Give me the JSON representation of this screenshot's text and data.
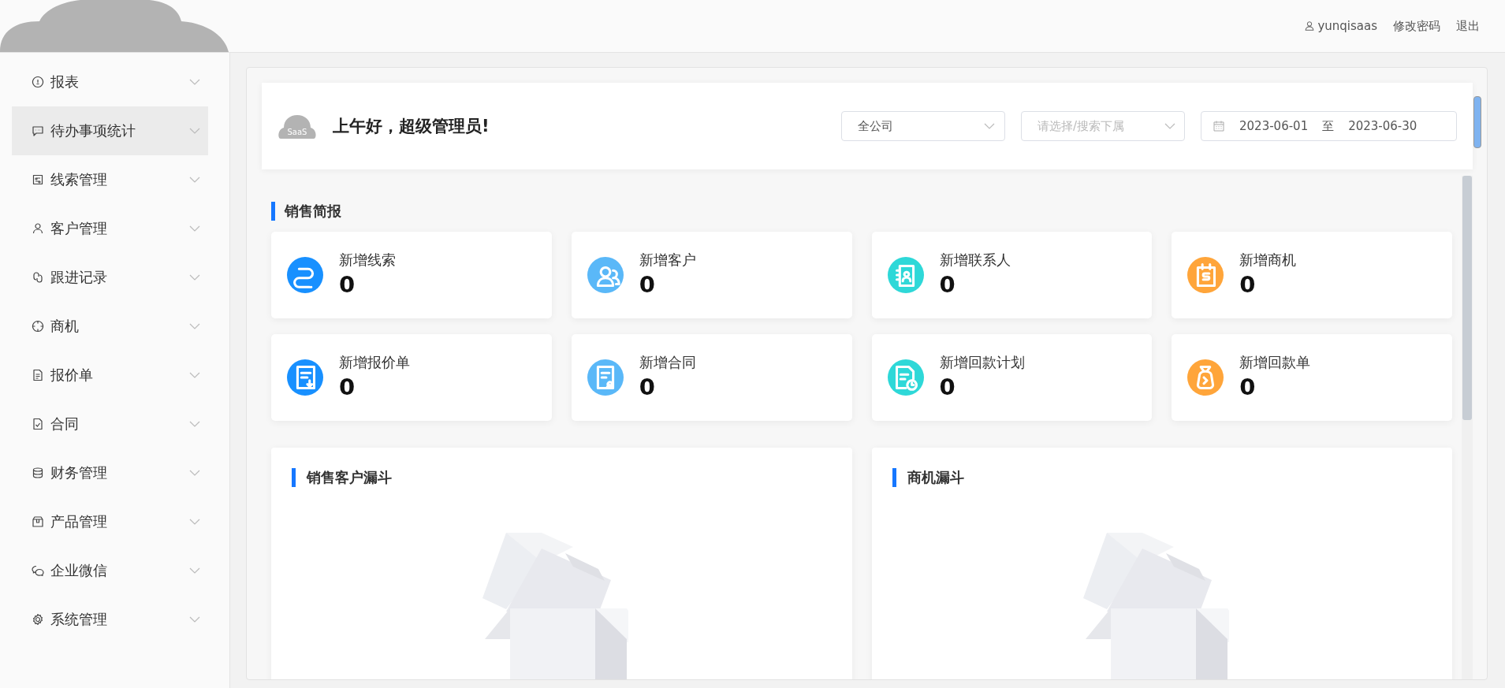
{
  "header": {
    "user": "yunqisaas",
    "links": [
      "修改密码",
      "退出"
    ]
  },
  "sidebar": {
    "items": [
      {
        "label": "报表",
        "selected": false
      },
      {
        "label": "待办事项统计",
        "selected": true
      },
      {
        "label": "线索管理",
        "selected": false
      },
      {
        "label": "客户管理",
        "selected": false
      },
      {
        "label": "跟进记录",
        "selected": false
      },
      {
        "label": "商机",
        "selected": false
      },
      {
        "label": "报价单",
        "selected": false
      },
      {
        "label": "合同",
        "selected": false
      },
      {
        "label": "财务管理",
        "selected": false
      },
      {
        "label": "产品管理",
        "selected": false
      },
      {
        "label": "企业微信",
        "selected": false
      },
      {
        "label": "系统管理",
        "selected": false
      }
    ]
  },
  "welcome": {
    "logo_text": "SaaS",
    "greeting": "上午好，超级管理员!",
    "company_select": "全公司",
    "subordinate_select": {
      "placeholder": "请选择/搜索下属"
    },
    "date_range": {
      "start": "2023-06-01",
      "separator": "至",
      "end": "2023-06-30"
    }
  },
  "sales_brief": {
    "title": "销售简报",
    "stats": [
      {
        "label": "新增线索",
        "value": "0",
        "color": "#1890ff"
      },
      {
        "label": "新增客户",
        "value": "0",
        "color": "#5ab8f8"
      },
      {
        "label": "新增联系人",
        "value": "0",
        "color": "#2ed8d8"
      },
      {
        "label": "新增商机",
        "value": "0",
        "color": "#ffa53a"
      },
      {
        "label": "新增报价单",
        "value": "0",
        "color": "#1890ff"
      },
      {
        "label": "新增合同",
        "value": "0",
        "color": "#5ab8f8"
      },
      {
        "label": "新增回款计划",
        "value": "0",
        "color": "#2ed8d8"
      },
      {
        "label": "新增回款单",
        "value": "0",
        "color": "#ffa53a"
      }
    ]
  },
  "funnels": [
    {
      "title": "销售客户漏斗"
    },
    {
      "title": "商机漏斗"
    }
  ]
}
